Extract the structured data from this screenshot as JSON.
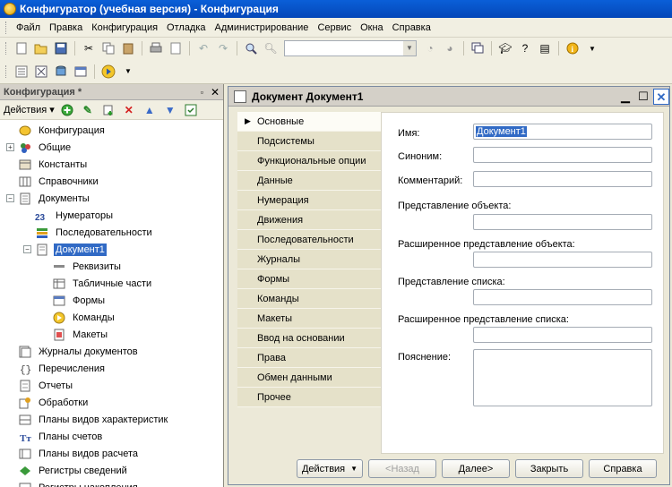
{
  "window": {
    "title": "Конфигуратор (учебная версия) - Конфигурация"
  },
  "menu": [
    "Файл",
    "Правка",
    "Конфигурация",
    "Отладка",
    "Администрирование",
    "Сервис",
    "Окна",
    "Справка"
  ],
  "left_panel": {
    "title": "Конфигурация *",
    "actions_label": "Действия",
    "tree": [
      {
        "label": "Конфигурация",
        "icon": "config-icon",
        "level": 0,
        "expander": ""
      },
      {
        "label": "Общие",
        "icon": "common-icon",
        "level": 0,
        "expander": "+"
      },
      {
        "label": "Константы",
        "icon": "constants-icon",
        "level": 0,
        "expander": ""
      },
      {
        "label": "Справочники",
        "icon": "catalogs-icon",
        "level": 0,
        "expander": ""
      },
      {
        "label": "Документы",
        "icon": "documents-icon",
        "level": 0,
        "expander": "−"
      },
      {
        "label": "Нумераторы",
        "icon": "numerators-icon",
        "level": 1,
        "expander": ""
      },
      {
        "label": "Последовательности",
        "icon": "sequences-icon",
        "level": 1,
        "expander": ""
      },
      {
        "label": "Документ1",
        "icon": "document-icon",
        "level": 1,
        "expander": "−",
        "selected": true
      },
      {
        "label": "Реквизиты",
        "icon": "attributes-icon",
        "level": 2,
        "expander": ""
      },
      {
        "label": "Табличные части",
        "icon": "tabular-icon",
        "level": 2,
        "expander": ""
      },
      {
        "label": "Формы",
        "icon": "forms-icon",
        "level": 2,
        "expander": ""
      },
      {
        "label": "Команды",
        "icon": "commands-icon",
        "level": 2,
        "expander": ""
      },
      {
        "label": "Макеты",
        "icon": "templates-icon",
        "level": 2,
        "expander": ""
      },
      {
        "label": "Журналы документов",
        "icon": "journals-icon",
        "level": 0,
        "expander": ""
      },
      {
        "label": "Перечисления",
        "icon": "enums-icon",
        "level": 0,
        "expander": ""
      },
      {
        "label": "Отчеты",
        "icon": "reports-icon",
        "level": 0,
        "expander": ""
      },
      {
        "label": "Обработки",
        "icon": "processing-icon",
        "level": 0,
        "expander": ""
      },
      {
        "label": "Планы видов характеристик",
        "icon": "char-plans-icon",
        "level": 0,
        "expander": ""
      },
      {
        "label": "Планы счетов",
        "icon": "accounts-icon",
        "level": 0,
        "expander": ""
      },
      {
        "label": "Планы видов расчета",
        "icon": "calc-plans-icon",
        "level": 0,
        "expander": ""
      },
      {
        "label": "Регистры сведений",
        "icon": "info-registers-icon",
        "level": 0,
        "expander": ""
      },
      {
        "label": "Регистры накопления",
        "icon": "accum-registers-icon",
        "level": 0,
        "expander": ""
      }
    ]
  },
  "doc_window": {
    "title": "Документ Документ1",
    "tabs": [
      "Основные",
      "Подсистемы",
      "Функциональные опции",
      "Данные",
      "Нумерация",
      "Движения",
      "Последовательности",
      "Журналы",
      "Формы",
      "Команды",
      "Макеты",
      "Ввод на основании",
      "Права",
      "Обмен данными",
      "Прочее"
    ],
    "active_tab": 0,
    "fields": {
      "name_label": "Имя:",
      "name_value": "Документ1",
      "synonym_label": "Синоним:",
      "comment_label": "Комментарий:",
      "obj_repr_label": "Представление объекта:",
      "ext_obj_repr_label": "Расширенное представление объекта:",
      "list_repr_label": "Представление списка:",
      "ext_list_repr_label": "Расширенное представление списка:",
      "explanation_label": "Пояснение:"
    },
    "buttons": {
      "actions": "Действия",
      "back": "<Назад",
      "next": "Далее>",
      "close": "Закрыть",
      "help": "Справка"
    }
  }
}
